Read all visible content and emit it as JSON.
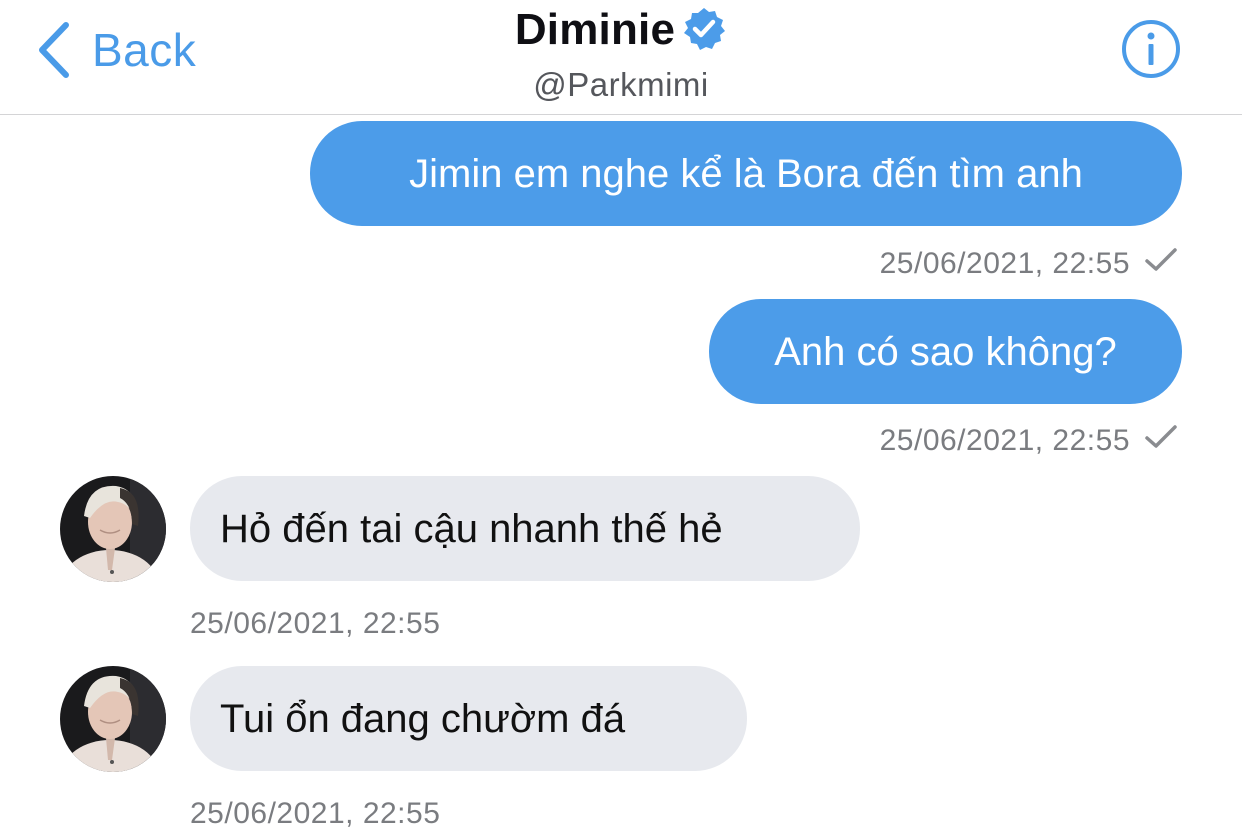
{
  "header": {
    "back_label": "Back",
    "name": "Diminie",
    "handle": "@Parkmimi"
  },
  "colors": {
    "accent": "#4c9ce9",
    "outgoing_bubble": "#4c9ce9",
    "incoming_bubble": "#e7e9ee",
    "timestamp": "#7a7c80"
  },
  "icons": {
    "back": "chevron-left-icon",
    "verified": "verified-badge-icon",
    "info": "info-icon",
    "sent": "checkmark-icon"
  },
  "messages": [
    {
      "direction": "outgoing",
      "text": "Jimin em nghe kể là Bora đến tìm anh",
      "time": "25/06/2021, 22:55",
      "status": "sent"
    },
    {
      "direction": "outgoing",
      "text": "Anh có sao không?",
      "time": "25/06/2021, 22:55",
      "status": "sent"
    },
    {
      "direction": "incoming",
      "text": "Hỏ đến tai cậu nhanh thế hẻ",
      "time": "25/06/2021, 22:55"
    },
    {
      "direction": "incoming",
      "text": "Tui ổn đang chườm đá",
      "time": "25/06/2021, 22:55"
    }
  ]
}
